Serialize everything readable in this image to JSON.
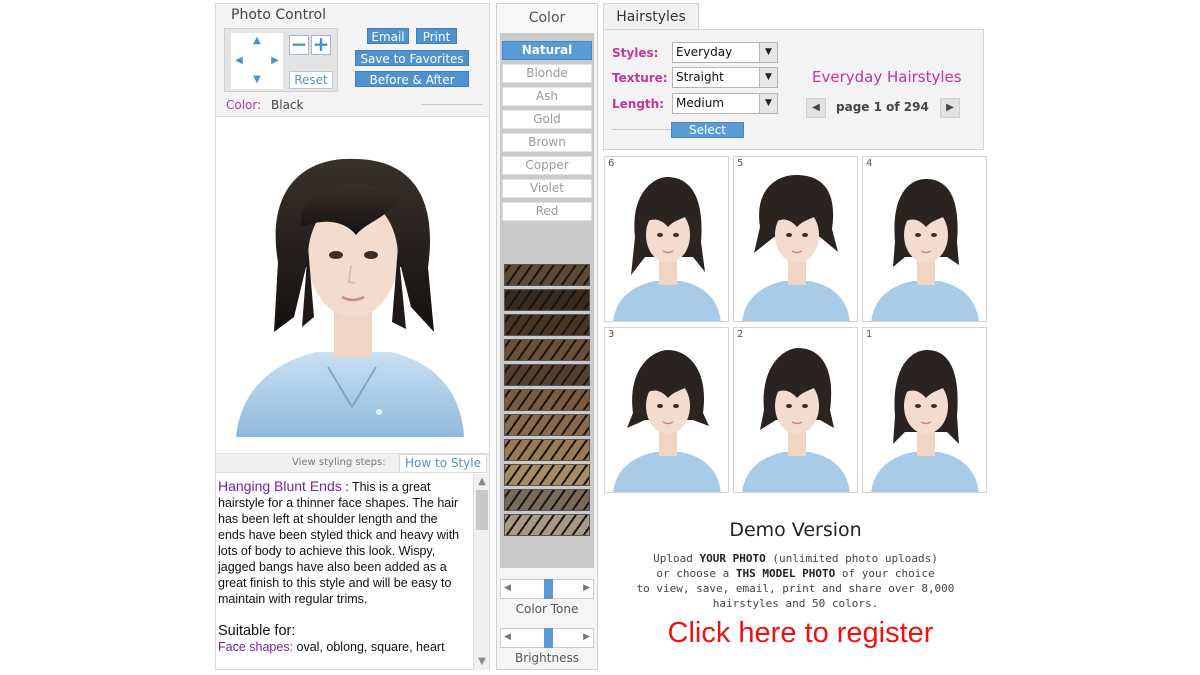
{
  "photo_control": {
    "title": "Photo Control",
    "arrows": {
      "up": "▲",
      "down": "▼",
      "left": "◀",
      "right": "▶"
    },
    "zoom_out": "−",
    "zoom_in": "+",
    "reset": "Reset",
    "email": "Email",
    "print": "Print",
    "save_favorites": "Save to Favorites",
    "before_after": "Before & After",
    "color_label": "Color:",
    "color_value": "Black"
  },
  "styling": {
    "view_steps_label": "View styling steps:",
    "how_to_style": "How to Style"
  },
  "description": {
    "title": "Hanging Blunt Ends",
    "body": " : This is a great hairstyle for a thinner face shapes. The hair has been left at shoulder length and the ends have been styled thick and heavy with lots of body to achieve this look. Wispy, jagged bangs have also been added as a great finish to this style and will be easy to maintain with regular trims.",
    "suitable_for": "Suitable for:",
    "face_shapes_label": "Face shapes:",
    "face_shapes_value": " oval, oblong, square, heart"
  },
  "color_panel": {
    "title": "Color",
    "options": [
      "Natural",
      "Blonde",
      "Ash",
      "Gold",
      "Brown",
      "Copper",
      "Violet",
      "Red"
    ],
    "active_index": 0,
    "swatches": [
      "#5b4a3a",
      "#3a2a1e",
      "#4a3522",
      "#6a5038",
      "#55402d",
      "#7a5c3e",
      "#8a6a48",
      "#9a7a55",
      "#a88a65",
      "#7a6a5a",
      "#a89888"
    ],
    "color_tone_label": "Color Tone",
    "color_tone_level": 0.5,
    "brightness_label": "Brightness",
    "brightness_level": 0.5
  },
  "hairstyles": {
    "tab": "Hairstyles",
    "styles_label": "Styles:",
    "styles_value": "Everyday",
    "texture_label": "Texture:",
    "texture_value": "Straight",
    "length_label": "Length:",
    "length_value": "Medium",
    "select_button": "Select",
    "category_title": "Everyday Hairstyles",
    "page_text": "page 1 of 294",
    "prev": "◀",
    "next": "▶",
    "thumbnails": [
      "6",
      "5",
      "4",
      "3",
      "2",
      "1"
    ]
  },
  "demo": {
    "title": "Demo Version",
    "line1_a": "Upload ",
    "line1_b": "YOUR PHOTO",
    "line1_c": " (unlimited photo uploads)",
    "line2_a": "or choose a ",
    "line2_b": "THS MODEL PHOTO",
    "line2_c": " of your choice",
    "line3": "to view, save, email, print and share over 8,000",
    "line4": "hairstyles and 50 colors.",
    "register": "Click here to register"
  },
  "colors": {
    "accent_blue": "#5a9bd5",
    "magenta_label": "#c2369b",
    "purple_title": "#7b1fa2",
    "register_red": "#ee1111",
    "hair_black": "#1f1a18",
    "skin": "#f3dccd",
    "shirt_blue": "#9fc5e6"
  }
}
